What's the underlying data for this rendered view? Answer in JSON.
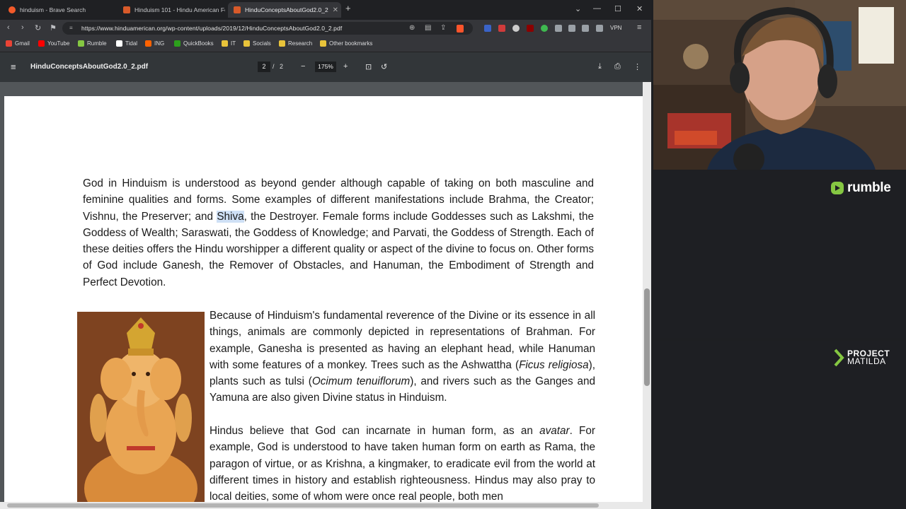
{
  "tabs": [
    {
      "title": "hinduism - Brave Search",
      "active": false
    },
    {
      "title": "Hinduism 101 - Hindu American Fo",
      "active": false
    },
    {
      "title": "HinduConceptsAboutGod2.0_2",
      "active": true
    }
  ],
  "toolbar": {
    "url": "https://www.hinduamerican.org/wp-content/uploads/2019/12/HinduConceptsAboutGod2.0_2.pdf",
    "vpn_label": "VPN"
  },
  "bookmarks": [
    {
      "label": "Gmail",
      "color": "#ea4335"
    },
    {
      "label": "YouTube",
      "color": "#ff0000"
    },
    {
      "label": "Rumble",
      "color": "#85c742"
    },
    {
      "label": "Tidal",
      "color": "#ffffff"
    },
    {
      "label": "ING",
      "color": "#ff6200"
    },
    {
      "label": "QuickBooks",
      "color": "#2ca01c"
    },
    {
      "label": "IT",
      "color": "#e8c33a"
    },
    {
      "label": "Socials",
      "color": "#e8c33a"
    },
    {
      "label": "Research",
      "color": "#e8c33a"
    },
    {
      "label": "Other bookmarks",
      "color": "#e8c33a"
    }
  ],
  "pdf": {
    "filename": "HinduConceptsAboutGod2.0_2.pdf",
    "current_page": "2",
    "page_sep": "/",
    "total_pages": "2",
    "zoom": "175%"
  },
  "document": {
    "para1_a": "God in Hinduism is understood as beyond gender although capable of taking on both masculine and feminine qualities and forms. Some examples of different manifestations include Brahma, the Creator; Vishnu, the Preserver; and ",
    "para1_hl": "Shiva",
    "para1_b": ", the Destroyer. Female forms include Goddesses such as Lakshmi, the Goddess of Wealth; Saraswati, the Goddess of Knowledge; and Parvati, the Goddess of Strength. Each of these deities offers the Hindu worshipper a different quality or aspect of the divine to focus on. Other forms of God include Ganesh, the Remover of Obstacles, and Hanuman, the Embodiment of Strength and Perfect Devotion.",
    "para2_a": "Because of Hinduism's fundamental reverence of the Divine or its essence in all things, animals are commonly depicted in representations of Brahman. For example, Ganesha is presented as having an elephant head, while Hanuman with some features of a monkey. Trees such as the Ashwattha (",
    "para2_i1": "Ficus religiosa",
    "para2_b": "), plants such as tulsi (",
    "para2_i2": "Ocimum tenuiflorum",
    "para2_c": "), and rivers such as the Ganges and Yamuna are also given Divine status in Hinduism.",
    "para3_a": "Hindus believe that God can incarnate in human form, as an ",
    "para3_i": "avatar",
    "para3_b": ". For example, God is understood to have taken human form on earth as Rama, the paragon of virtue, or as Krishna, a kingmaker, to eradicate evil from the world at different times in history and establish righteousness. Hindus may also pray to local deities, some of whom were once real people, both men"
  },
  "overlay": {
    "rumble": "rumble",
    "matilda_1": "PROJECT",
    "matilda_2": "MATILDA"
  }
}
